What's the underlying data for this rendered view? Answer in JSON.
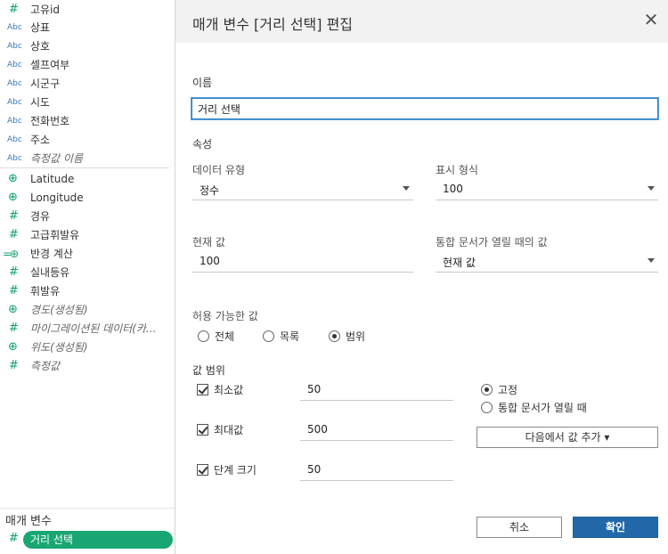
{
  "fields": [
    {
      "icon": "#",
      "icon_name": "number-icon",
      "label": "고유id",
      "italic": false
    },
    {
      "icon": "Abc",
      "icon_name": "string-icon",
      "label": "상표",
      "italic": false
    },
    {
      "icon": "Abc",
      "icon_name": "string-icon",
      "label": "상호",
      "italic": false
    },
    {
      "icon": "Abc",
      "icon_name": "string-icon",
      "label": "셀프여부",
      "italic": false
    },
    {
      "icon": "Abc",
      "icon_name": "string-icon",
      "label": "시군구",
      "italic": false
    },
    {
      "icon": "Abc",
      "icon_name": "string-icon",
      "label": "시도",
      "italic": false
    },
    {
      "icon": "Abc",
      "icon_name": "string-icon",
      "label": "전화번호",
      "italic": false
    },
    {
      "icon": "Abc",
      "icon_name": "string-icon",
      "label": "주소",
      "italic": false
    },
    {
      "icon": "Abc",
      "icon_name": "string-icon",
      "label": "측정값 이름",
      "italic": true
    },
    {
      "icon": "⊕",
      "icon_name": "globe-icon",
      "label": "Latitude",
      "italic": false
    },
    {
      "icon": "⊕",
      "icon_name": "globe-icon",
      "label": "Longitude",
      "italic": false
    },
    {
      "icon": "#",
      "icon_name": "number-icon",
      "label": "경유",
      "italic": false
    },
    {
      "icon": "#",
      "icon_name": "number-icon",
      "label": "고급휘발유",
      "italic": false
    },
    {
      "icon": "=⊕",
      "icon_name": "calculated-globe-icon",
      "label": "반경 계산",
      "italic": false
    },
    {
      "icon": "#",
      "icon_name": "number-icon",
      "label": "실내등유",
      "italic": false
    },
    {
      "icon": "#",
      "icon_name": "number-icon",
      "label": "휘발유",
      "italic": false
    },
    {
      "icon": "⊕",
      "icon_name": "globe-icon",
      "label": "경도(생성됨)",
      "italic": true
    },
    {
      "icon": "#",
      "icon_name": "number-icon",
      "label": "마이그레이션된 데이터(카...",
      "italic": true
    },
    {
      "icon": "⊕",
      "icon_name": "globe-icon",
      "label": "위도(생성됨)",
      "italic": true
    },
    {
      "icon": "#",
      "icon_name": "number-icon",
      "label": "측정값",
      "italic": true
    }
  ],
  "parameters": {
    "header": "매개 변수",
    "item_icon": "#",
    "item_label": "거리 선택"
  },
  "dialog": {
    "title": "매개 변수 [거리 선택] 편집",
    "close_glyph": "✕",
    "name_label": "이름",
    "name_value": "거리 선택",
    "properties_label": "속성",
    "data_type_label": "데이터 유형",
    "data_type_value": "정수",
    "display_format_label": "표시 형식",
    "display_format_value": "100",
    "current_value_label": "현재 값",
    "current_value": "100",
    "workbook_open_label": "통합 문서가 열릴 때의 값",
    "workbook_open_value": "현재 값",
    "allowable_label": "허용 가능한 값",
    "allowable_options": [
      "전체",
      "목록",
      "범위"
    ],
    "allowable_selected": 2,
    "range_label": "값 범위",
    "min_label": "최소값",
    "min_value": "50",
    "max_label": "최대값",
    "max_value": "500",
    "step_label": "단계 크기",
    "step_value": "50",
    "fixed_label": "고정",
    "workbook_open_option": "통합 문서가 열릴 때",
    "add_from_label": "다음에서 값 추가 ▾",
    "cancel_label": "취소",
    "ok_label": "확인",
    "accent_color": "#2268a8",
    "pill_color": "#1aa672"
  }
}
